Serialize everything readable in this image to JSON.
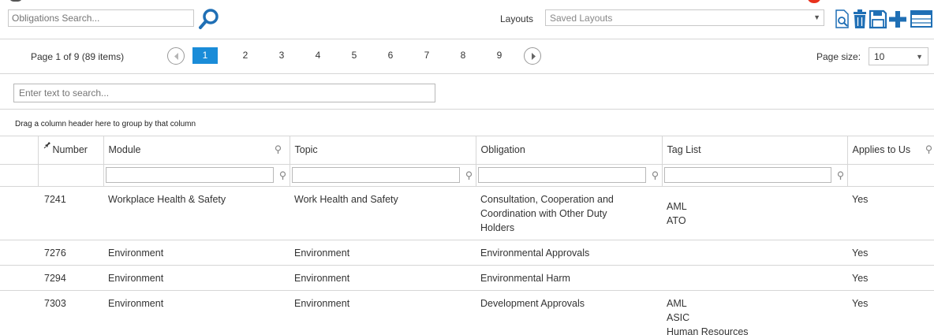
{
  "toolbar": {
    "search_placeholder": "Obligations Search...",
    "layouts_label": "Layouts",
    "layouts_value": "Saved Layouts"
  },
  "pager": {
    "summary": "Page 1 of 9 (89 items)",
    "pages": [
      "1",
      "2",
      "3",
      "4",
      "5",
      "6",
      "7",
      "8",
      "9"
    ],
    "active_page": "1",
    "page_size_label": "Page size:",
    "page_size_value": "10"
  },
  "grid": {
    "search_placeholder": "Enter text to search...",
    "group_hint": "Drag a column header here to group by that column",
    "columns": {
      "number": "Number",
      "module": "Module",
      "topic": "Topic",
      "obligation": "Obligation",
      "tag_list": "Tag List",
      "applies": "Applies to Us"
    },
    "rows": [
      {
        "number": "7241",
        "module": "Workplace Health & Safety",
        "topic": "Work Health and Safety",
        "obligation": [
          "Consultation, Cooperation and",
          "Coordination with Other Duty",
          "Holders"
        ],
        "tags": [
          "AML",
          "ATO"
        ],
        "applies": "Yes"
      },
      {
        "number": "7276",
        "module": "Environment",
        "topic": "Environment",
        "obligation": [
          "Environmental Approvals"
        ],
        "tags": [],
        "applies": "Yes"
      },
      {
        "number": "7294",
        "module": "Environment",
        "topic": "Environment",
        "obligation": [
          "Environmental Harm"
        ],
        "tags": [],
        "applies": "Yes"
      },
      {
        "number": "7303",
        "module": "Environment",
        "topic": "Environment",
        "obligation": [
          "Development Approvals"
        ],
        "tags": [
          "AML",
          "ASIC",
          "Human Resources"
        ],
        "applies": "Yes"
      }
    ]
  },
  "colors": {
    "accent": "#1a8cd8",
    "icon_blue": "#1f6fb5",
    "notification": "#e8311d"
  },
  "icons": [
    "search-icon",
    "print-preview-icon",
    "delete-icon",
    "save-icon",
    "add-icon",
    "export-icon",
    "pin-icon",
    "filter-icon",
    "chevron-left-icon",
    "chevron-right-icon"
  ]
}
